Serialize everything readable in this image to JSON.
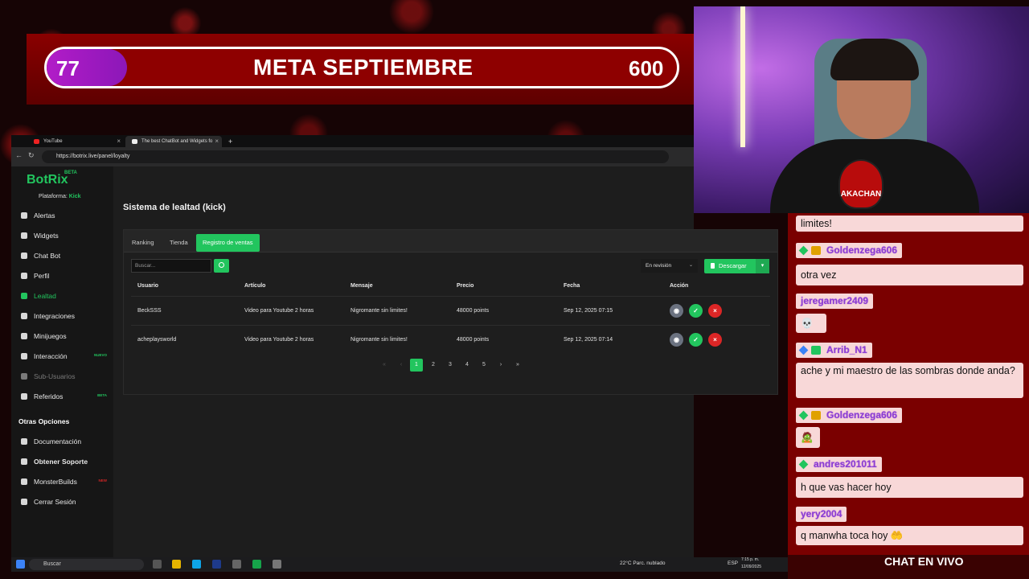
{
  "meta": {
    "current": "77",
    "title": "META SEPTIEMBRE",
    "goal": "600",
    "progress": 0.128
  },
  "webcam": {
    "logo_text": "AKACHAN"
  },
  "browser": {
    "tabs": [
      "YouTube",
      "The best ChatBot and Widgets fo"
    ],
    "url": "https://botrix.live/panel/loyalty"
  },
  "sidebar": {
    "brand": "BotRix",
    "beta": "BETA",
    "platform_label": "Plataforma:",
    "platform_value": "Kick",
    "items": [
      {
        "label": "Alertas"
      },
      {
        "label": "Widgets"
      },
      {
        "label": "Chat Bot"
      },
      {
        "label": "Perfil"
      },
      {
        "label": "Lealtad"
      },
      {
        "label": "Integraciones"
      },
      {
        "label": "Minijuegos"
      },
      {
        "label": "Interacción",
        "tag": "NUEVO"
      },
      {
        "label": "Sub-Usuarios"
      },
      {
        "label": "Referidos",
        "tag": "BETA"
      }
    ],
    "other_title": "Otras Opciones",
    "other_items": [
      {
        "label": "Documentación"
      },
      {
        "label": "Obtener Soporte"
      },
      {
        "label": "MonsterBuilds",
        "tag": "NEW"
      },
      {
        "label": "Cerrar Sesión"
      }
    ]
  },
  "content": {
    "title": "Sistema de lealtad (kick)",
    "tabs": [
      "Ranking",
      "Tienda",
      "Registro de ventas"
    ],
    "search_placeholder": "Buscar...",
    "filter": "En revisión",
    "download": "Descargar",
    "columns": [
      "Usuario",
      "Artículo",
      "Mensaje",
      "Precio",
      "Fecha",
      "Acción"
    ],
    "rows": [
      {
        "user": "BeckSSS",
        "item": "Video para Youtube 2 horas",
        "message": "Nigromante sin limites!",
        "price": "48000 points",
        "date": "Sep 12, 2025 07:15"
      },
      {
        "user": "acheplaysworld",
        "item": "Video para Youtube 2 horas",
        "message": "Nigromante sin limites!",
        "price": "48000 points",
        "date": "Sep 12, 2025 07:14"
      }
    ],
    "pages": [
      "1",
      "2",
      "3",
      "4",
      "5"
    ]
  },
  "taskbar": {
    "search": "Buscar",
    "weather": "22°C  Parc. nublado",
    "lang": "ESP",
    "time": "7:15 p. m.",
    "date": "12/09/2025"
  },
  "chat": {
    "footer": "CHAT EN VIVO",
    "messages": [
      {
        "text": "limites!"
      },
      {
        "name": "Goldenzega606",
        "text": "otra vez"
      },
      {
        "name": "jeregamer2409",
        "text": "💀"
      },
      {
        "name": "Arrib_N1",
        "text": "ache y mi maestro de las sombras donde anda?"
      },
      {
        "name": "Goldenzega606",
        "text": "🧟"
      },
      {
        "name": "andres201011",
        "text": "h que vas hacer hoy"
      },
      {
        "name": "yery2004",
        "text": "q manwha toca hoy 🤲"
      }
    ]
  }
}
